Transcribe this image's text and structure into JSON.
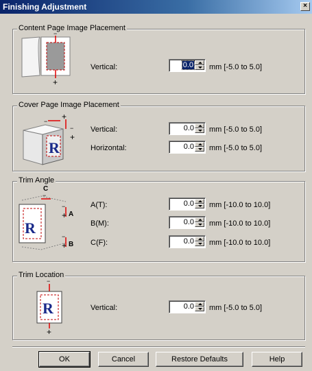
{
  "window": {
    "title": "Finishing Adjustment",
    "close_glyph": "×"
  },
  "groups": {
    "content": {
      "legend": "Content Page Image Placement",
      "fields": [
        {
          "label": "Vertical:",
          "value": "0.0",
          "range": "mm [-5.0 to 5.0]"
        }
      ]
    },
    "cover": {
      "legend": "Cover Page Image Placement",
      "fields": [
        {
          "label": "Vertical:",
          "value": "0.0",
          "range": "mm [-5.0 to 5.0]"
        },
        {
          "label": "Horizontal:",
          "value": "0.0",
          "range": "mm [-5.0 to 5.0]"
        }
      ]
    },
    "trim_angle": {
      "legend": "Trim Angle",
      "fields": [
        {
          "label": "A(T):",
          "value": "0.0",
          "range": "mm [-10.0 to 10.0]"
        },
        {
          "label": "B(M):",
          "value": "0.0",
          "range": "mm [-10.0 to 10.0]"
        },
        {
          "label": "C(F):",
          "value": "0.0",
          "range": "mm [-10.0 to 10.0]"
        }
      ]
    },
    "trim_location": {
      "legend": "Trim Location",
      "fields": [
        {
          "label": "Vertical:",
          "value": "0.0",
          "range": "mm [-5.0 to 5.0]"
        }
      ]
    }
  },
  "illustration_text": {
    "plus": "+",
    "minus": "−",
    "R": "R",
    "A": "A",
    "B": "B",
    "C": "C"
  },
  "buttons": {
    "ok": "OK",
    "cancel": "Cancel",
    "restore": "Restore Defaults",
    "help": "Help"
  },
  "colors": {
    "titlebar": "#0a246a",
    "accent_red": "#e00000",
    "r_blue": "#1a2a8a"
  }
}
